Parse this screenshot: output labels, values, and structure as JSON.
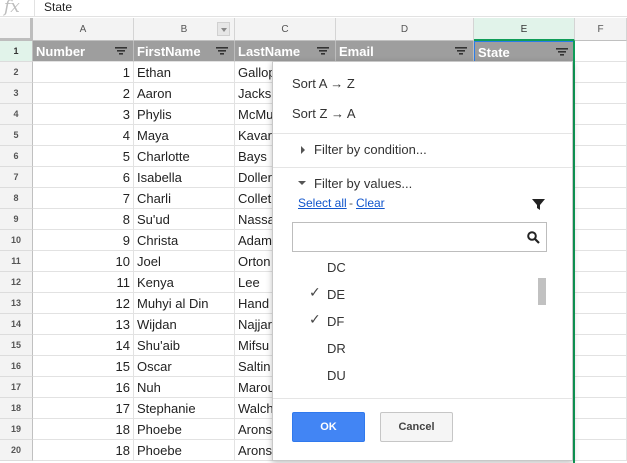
{
  "formula_bar": {
    "fx_label": "fx",
    "value": "State"
  },
  "columns": [
    "A",
    "B",
    "C",
    "D",
    "E",
    "F"
  ],
  "header_row": {
    "row_number": "1",
    "cells": [
      "Number",
      "FirstName",
      "LastName",
      "Email",
      "State"
    ]
  },
  "rows": [
    {
      "row_number": "2",
      "number": "1",
      "first": "Ethan",
      "last": "Gallop"
    },
    {
      "row_number": "3",
      "number": "2",
      "first": "Aaron",
      "last": "Jacks"
    },
    {
      "row_number": "4",
      "number": "3",
      "first": "Phylis",
      "last": "McMu"
    },
    {
      "row_number": "5",
      "number": "4",
      "first": "Maya",
      "last": "Kavar"
    },
    {
      "row_number": "6",
      "number": "5",
      "first": "Charlotte",
      "last": "Bays"
    },
    {
      "row_number": "7",
      "number": "6",
      "first": "Isabella",
      "last": "Doller"
    },
    {
      "row_number": "8",
      "number": "7",
      "first": "Charli",
      "last": "Collet"
    },
    {
      "row_number": "9",
      "number": "8",
      "first": "Su'ud",
      "last": "Nassa"
    },
    {
      "row_number": "10",
      "number": "9",
      "first": "Christa",
      "last": "Adam"
    },
    {
      "row_number": "11",
      "number": "10",
      "first": "Joel",
      "last": "Orton"
    },
    {
      "row_number": "12",
      "number": "11",
      "first": "Kenya",
      "last": "Lee"
    },
    {
      "row_number": "13",
      "number": "12",
      "first": "Muhyi al Din",
      "last": "Hand"
    },
    {
      "row_number": "14",
      "number": "13",
      "first": "Wijdan",
      "last": "Najjar"
    },
    {
      "row_number": "15",
      "number": "14",
      "first": "Shu'aib",
      "last": "Mifsu"
    },
    {
      "row_number": "16",
      "number": "15",
      "first": "Oscar",
      "last": "Saltin"
    },
    {
      "row_number": "17",
      "number": "16",
      "first": "Nuh",
      "last": "Marou"
    },
    {
      "row_number": "18",
      "number": "17",
      "first": "Stephanie",
      "last": "Walch"
    },
    {
      "row_number": "19",
      "number": "18",
      "first": "Phoebe",
      "last": "Arons"
    },
    {
      "row_number": "20",
      "number": "18",
      "first": "Phoebe",
      "last": "Arons"
    }
  ],
  "filter_menu": {
    "sort_az": "Sort A → Z",
    "sort_za": "Sort Z → A",
    "filter_by_condition": "Filter by condition...",
    "filter_by_values": "Filter by values...",
    "select_all": "Select all",
    "separator": "-",
    "clear": "Clear",
    "search_value": "",
    "values": [
      {
        "label": "DC",
        "checked": false
      },
      {
        "label": "DE",
        "checked": true
      },
      {
        "label": "DF",
        "checked": true
      },
      {
        "label": "DR",
        "checked": false
      },
      {
        "label": "DU",
        "checked": false
      }
    ],
    "check_mark": "✓",
    "ok_label": "OK",
    "cancel_label": "Cancel"
  },
  "colors": {
    "header_fill": "#9e9e9e",
    "selected_column": "#e1f3ea",
    "selection_border": "#0f9d58",
    "link": "#1155cc",
    "ok_button": "#4285f4"
  },
  "icons": [
    "filter-icon",
    "search-icon",
    "filter-funnel-icon",
    "triangle-right-icon",
    "triangle-down-icon",
    "checkmark-icon",
    "column-dropdown-arrow-icon"
  ]
}
